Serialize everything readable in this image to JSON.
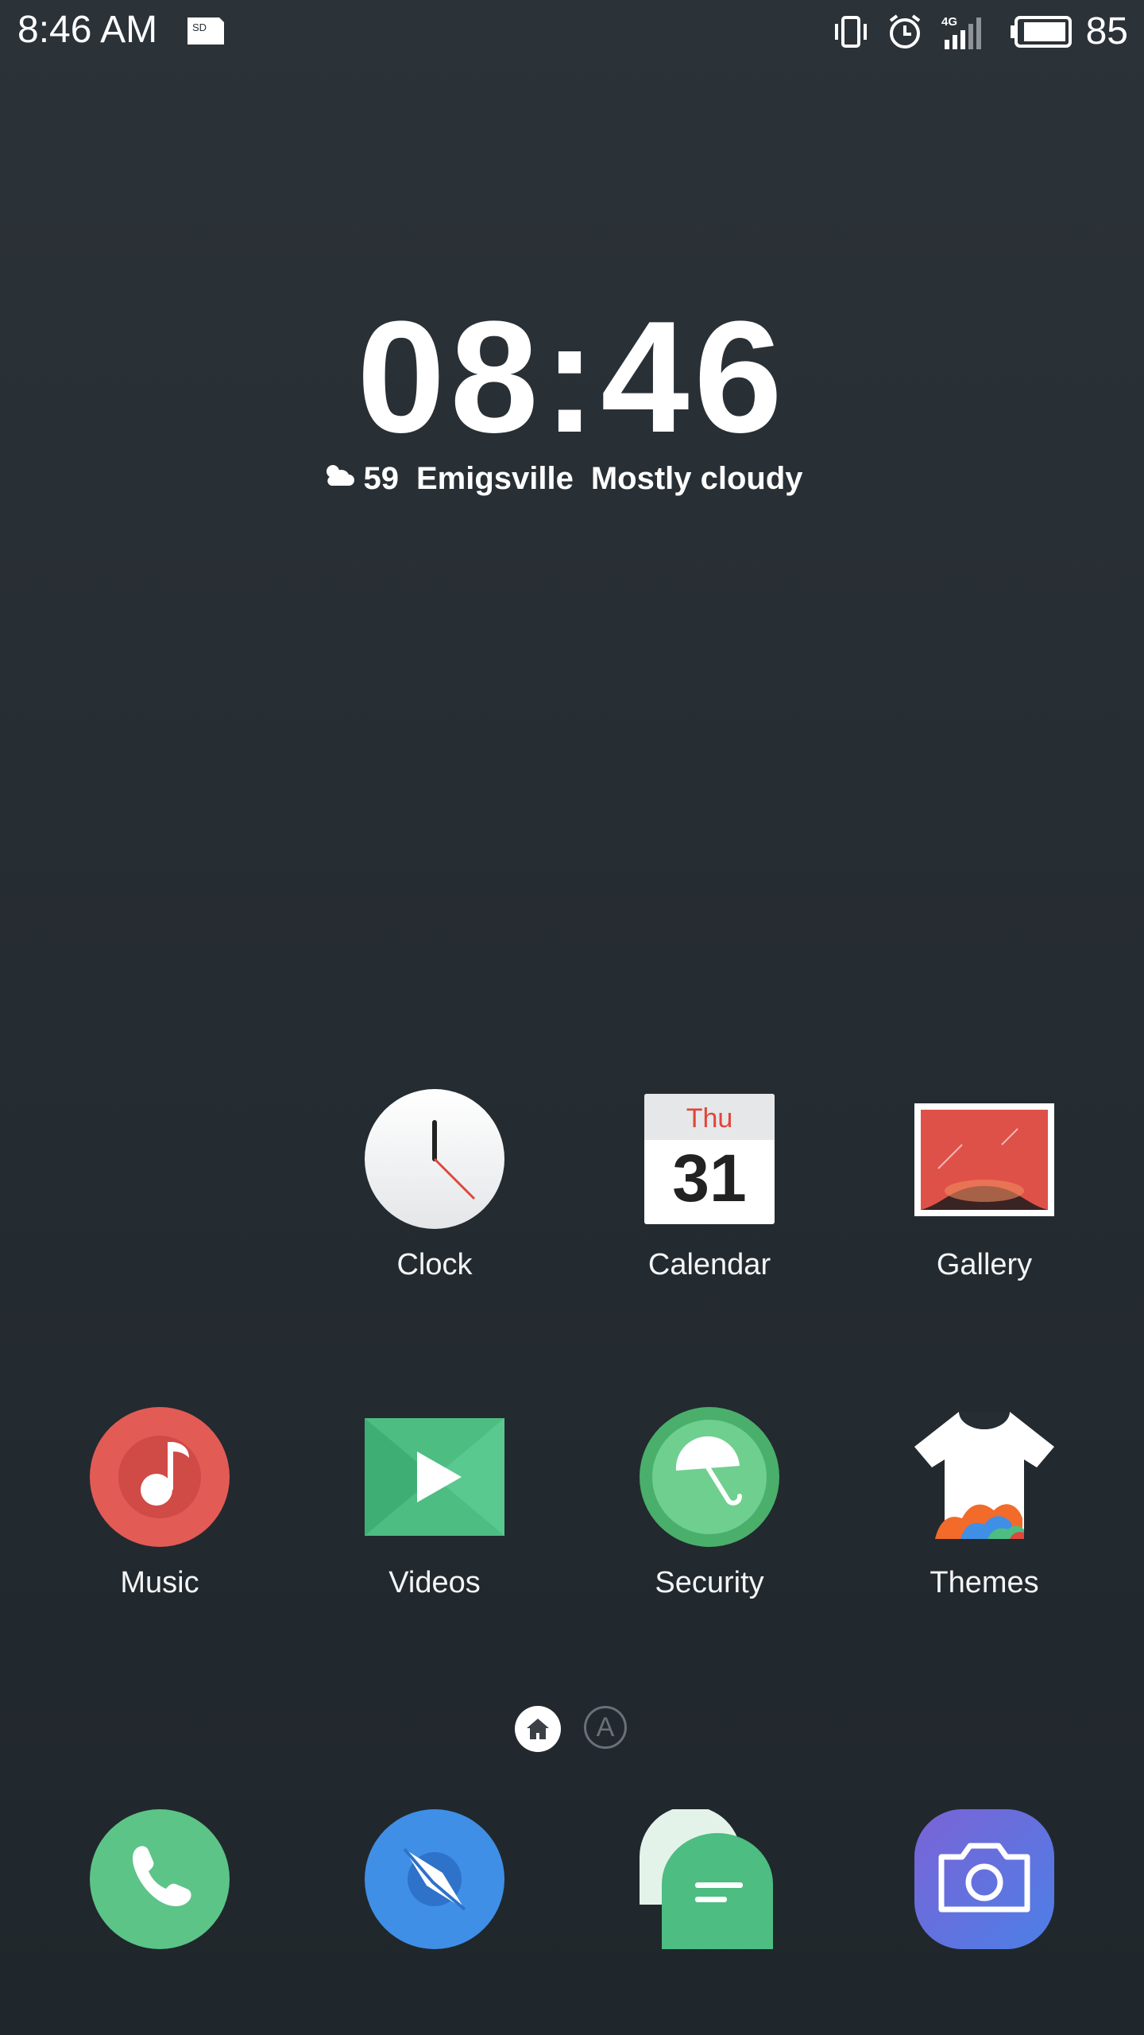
{
  "status_bar": {
    "time": "8:46 AM",
    "network": "4G",
    "battery": "85",
    "icons": [
      "sd-card-icon",
      "vibrate-icon",
      "alarm-icon",
      "signal-4g-icon",
      "battery-icon"
    ]
  },
  "clock_widget": {
    "time": "08:46",
    "weather_icon": "cloud-sun-icon",
    "temperature": "59",
    "location": "Emigsville",
    "condition": "Mostly cloudy"
  },
  "apps": {
    "clock": {
      "label": "Clock"
    },
    "calendar": {
      "label": "Calendar",
      "day": "Thu",
      "date": "31"
    },
    "gallery": {
      "label": "Gallery"
    },
    "music": {
      "label": "Music"
    },
    "videos": {
      "label": "Videos"
    },
    "security": {
      "label": "Security"
    },
    "themes": {
      "label": "Themes"
    }
  },
  "page_indicator": {
    "pages": [
      "home",
      "A"
    ],
    "active": "home",
    "app_page_letter": "A"
  },
  "dock": [
    "phone-icon",
    "browser-icon",
    "messages-icon",
    "camera-icon"
  ],
  "colors": {
    "background": "#262d33",
    "music": "#e35b55",
    "videos": "#4dbd82",
    "security": "#4aaf6b",
    "phone": "#5cc487",
    "browser": "#3f8fe6",
    "camera": "#6c6fdc",
    "calendar_day": "#e0463d"
  }
}
